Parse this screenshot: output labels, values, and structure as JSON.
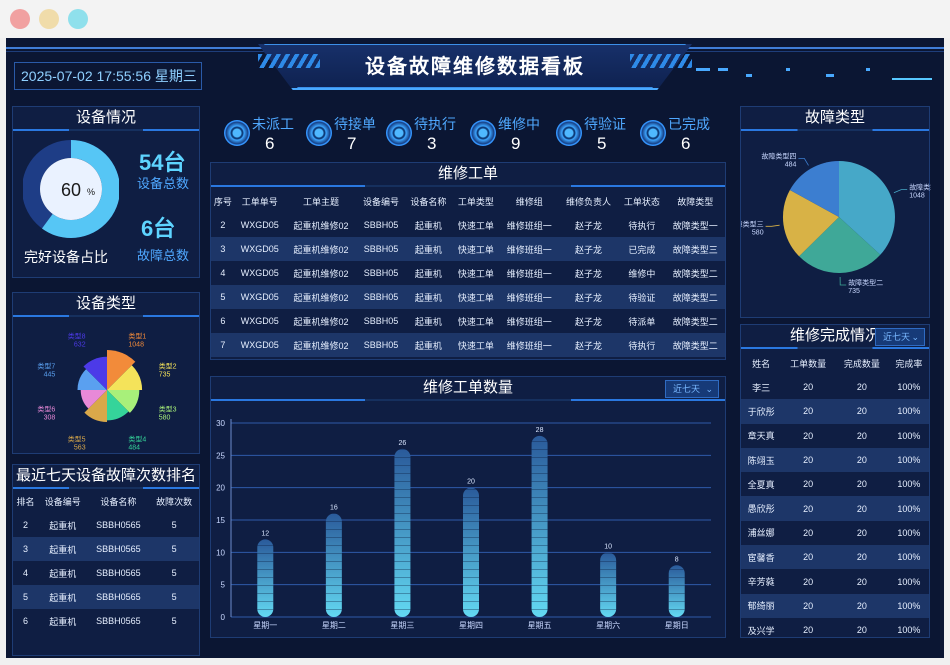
{
  "header": {
    "title": "设备故障维修数据看板",
    "datetime": "2025-07-02 17:55:56 星期三"
  },
  "equipment_status": {
    "title": "设备情况",
    "percent_label": "60",
    "percent_unit": "%",
    "percent_value": 0.6,
    "ratio_label": "完好设备占比",
    "total_value": "54台",
    "total_label": "设备总数",
    "fault_value": "6台",
    "fault_label": "故障总数"
  },
  "equipment_types": {
    "title": "设备类型"
  },
  "status_counters": [
    {
      "label": "未派工",
      "count": "6"
    },
    {
      "label": "待接单",
      "count": "7"
    },
    {
      "label": "待执行",
      "count": "3"
    },
    {
      "label": "维修中",
      "count": "9"
    },
    {
      "label": "待验证",
      "count": "5"
    },
    {
      "label": "已完成",
      "count": "6"
    }
  ],
  "work_orders": {
    "title": "维修工单",
    "columns": [
      "序号",
      "工单单号",
      "工单主题",
      "设备编号",
      "设备名称",
      "工单类型",
      "维修组",
      "维修负责人",
      "工单状态",
      "故障类型"
    ],
    "rows": [
      [
        "2",
        "WXGD05",
        "起重机维修02",
        "SBBH05",
        "起重机",
        "快速工单",
        "维修班组一",
        "赵子龙",
        "待执行",
        "故障类型一"
      ],
      [
        "3",
        "WXGD05",
        "起重机维修02",
        "SBBH05",
        "起重机",
        "快速工单",
        "维修班组一",
        "赵子龙",
        "已完成",
        "故障类型三"
      ],
      [
        "4",
        "WXGD05",
        "起重机维修02",
        "SBBH05",
        "起重机",
        "快速工单",
        "维修班组一",
        "赵子龙",
        "维修中",
        "故障类型二"
      ],
      [
        "5",
        "WXGD05",
        "起重机维修02",
        "SBBH05",
        "起重机",
        "快速工单",
        "维修班组一",
        "赵子龙",
        "待验证",
        "故障类型二"
      ],
      [
        "6",
        "WXGD05",
        "起重机维修02",
        "SBBH05",
        "起重机",
        "快速工单",
        "维修班组一",
        "赵子龙",
        "待派单",
        "故障类型二"
      ],
      [
        "7",
        "WXGD05",
        "起重机维修02",
        "SBBH05",
        "起重机",
        "快速工单",
        "维修班组一",
        "赵子龙",
        "待执行",
        "故障类型二"
      ]
    ]
  },
  "ranking": {
    "title": "最近七天设备故障次数排名",
    "columns": [
      "排名",
      "设备编号",
      "设备名称",
      "故障次数"
    ],
    "rows": [
      [
        "2",
        "起重机",
        "SBBH0565",
        "5"
      ],
      [
        "3",
        "起重机",
        "SBBH0565",
        "5"
      ],
      [
        "4",
        "起重机",
        "SBBH0565",
        "5"
      ],
      [
        "5",
        "起重机",
        "SBBH0565",
        "5"
      ],
      [
        "6",
        "起重机",
        "SBBH0565",
        "5"
      ]
    ]
  },
  "work_order_count": {
    "title": "维修工单数量",
    "dropdown": "近七天"
  },
  "fault_types": {
    "title": "故障类型"
  },
  "completion": {
    "title": "维修完成情况",
    "dropdown": "近七天",
    "columns": [
      "姓名",
      "工单数量",
      "完成数量",
      "完成率"
    ],
    "rows": [
      [
        "李三",
        "20",
        "20",
        "100%"
      ],
      [
        "于欣彤",
        "20",
        "20",
        "100%"
      ],
      [
        "章天真",
        "20",
        "20",
        "100%"
      ],
      [
        "陈翊玉",
        "20",
        "20",
        "100%"
      ],
      [
        "全夏真",
        "20",
        "20",
        "100%"
      ],
      [
        "愚欣彤",
        "20",
        "20",
        "100%"
      ],
      [
        "浦丝娜",
        "20",
        "20",
        "100%"
      ],
      [
        "宦馨香",
        "20",
        "20",
        "100%"
      ],
      [
        "辛芳蕤",
        "20",
        "20",
        "100%"
      ],
      [
        "郁绮丽",
        "20",
        "20",
        "100%"
      ],
      [
        "及兴学",
        "20",
        "20",
        "100%"
      ]
    ]
  },
  "colors": {
    "background": "#0b1633",
    "panel": "#0f1e43",
    "accent": "#4fa8ff",
    "highlight": "#5ed4ff"
  },
  "chart_data": [
    {
      "type": "pie",
      "subtype": "rose",
      "title": "",
      "categories": [
        "类型1",
        "类型2",
        "类型3",
        "类型4",
        "类型5",
        "类型6",
        "类型7",
        "类型8"
      ],
      "values": [
        1048,
        735,
        580,
        484,
        563,
        308,
        445,
        632
      ],
      "colors": [
        "#f28b3a",
        "#f4e35a",
        "#a8f07a",
        "#35d49a",
        "#d9a84a",
        "#e889d8",
        "#5aa0f0",
        "#4c3ae8"
      ]
    },
    {
      "type": "bar",
      "title": "",
      "categories": [
        "星期一",
        "星期二",
        "星期三",
        "星期四",
        "星期五",
        "星期六",
        "星期日"
      ],
      "values": [
        12,
        16,
        26,
        20,
        28,
        10,
        8
      ],
      "ylim": [
        0,
        30
      ],
      "yticks": [
        0,
        5,
        10,
        15,
        20,
        25,
        30
      ],
      "grid": true
    },
    {
      "type": "pie",
      "title": "",
      "categories": [
        "故障类型一",
        "故障类型二",
        "故障类型三",
        "故障类型四"
      ],
      "values": [
        1048,
        735,
        580,
        484
      ],
      "colors": [
        "#46a8c8",
        "#3fa898",
        "#d8b246",
        "#3c7ed0"
      ]
    }
  ]
}
